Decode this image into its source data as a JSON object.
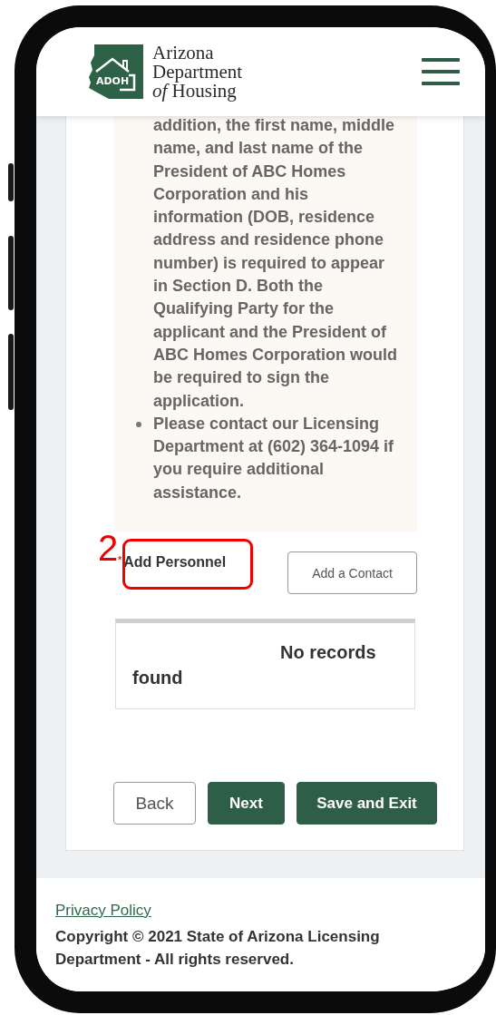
{
  "header": {
    "logo_badge": "ADOH",
    "agency_name": [
      "Arizona",
      "Department",
      "*of* Housing"
    ],
    "menu": {
      "expanded": false
    }
  },
  "info_items": [
    {
      "kind": "continued",
      "text": "addition, the first name, middle name, and last name of the President of ABC Homes Corporation and his information (DOB, residence address and residence phone number) is required to appear in Section D. Both the Qualifying Party for the applicant and the President of ABC Homes Corporation would be required to sign the application."
    },
    {
      "kind": "bullet",
      "text": "Please contact our Licensing Department at (602) 364-1094 if you require additional assistance."
    }
  ],
  "personnel": {
    "label": "Add Personnel",
    "required_mark": "*",
    "add_button": "Add a Contact",
    "empty_message": "No records found"
  },
  "annotation": {
    "label": "2"
  },
  "buttons": [
    {
      "label": "Back",
      "kind": "secondary"
    },
    {
      "label": "Next",
      "kind": "primary"
    },
    {
      "label": "Save and Exit",
      "kind": "primary"
    }
  ],
  "footer": {
    "link": "Privacy Policy",
    "copyright": "Copyright © 2021 State of Arizona Licensing Department - All rights reserved."
  }
}
